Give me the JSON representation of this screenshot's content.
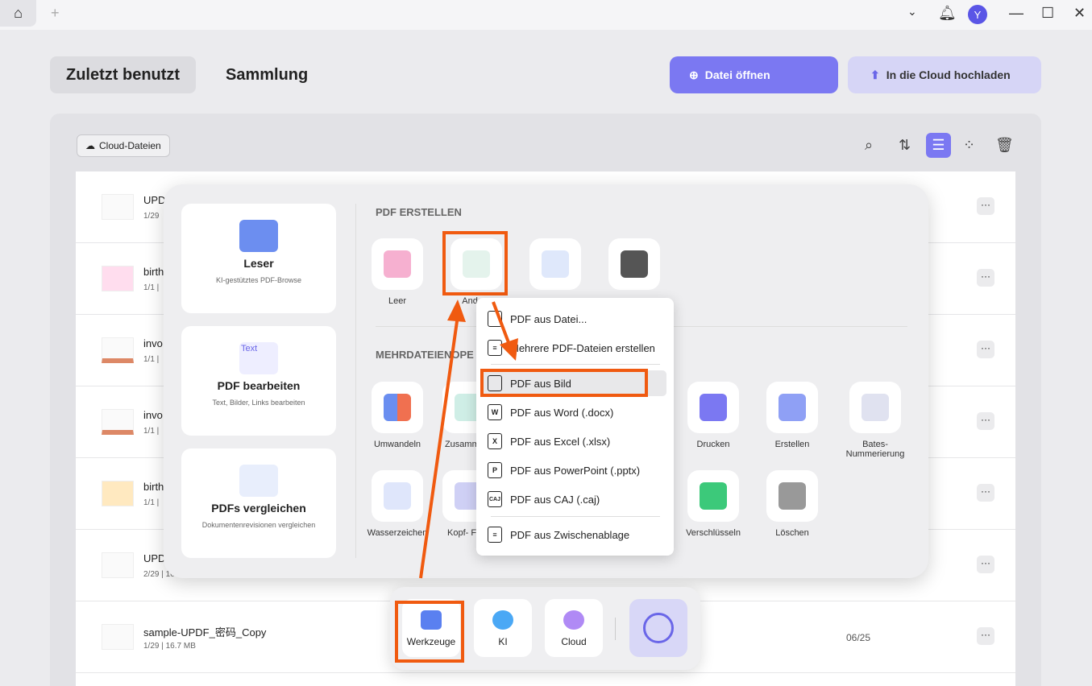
{
  "titlebar": {
    "home_icon": "home-icon",
    "add_tab": "+",
    "avatar": "Y"
  },
  "tabs": [
    {
      "label": "Zuletzt benutzt",
      "active": true
    },
    {
      "label": "Sammlung"
    }
  ],
  "actions": {
    "open": "Datei öffnen",
    "upload": "In die Cloud hochladen"
  },
  "cloud_files": "Cloud-Dateien",
  "files": [
    {
      "name": "UPDF",
      "meta": "1/29"
    },
    {
      "name": "birth",
      "meta": "1/1 |"
    },
    {
      "name": "invo",
      "meta": "1/1 |"
    },
    {
      "name": "invo",
      "meta": "1/1 |"
    },
    {
      "name": "birth",
      "meta": "1/1 |"
    },
    {
      "name": "UPD",
      "meta": "2/29 | 16."
    },
    {
      "name": "sample-UPDF_密码_Copy",
      "meta": "1/29 | 16.7 MB",
      "date": "06/25"
    }
  ],
  "tools_panel": {
    "cards": [
      {
        "title": "Leser",
        "sub": "KI-gestütztes PDF-Browse"
      },
      {
        "title": "PDF bearbeiten",
        "sub": "Text, Bilder, Links bearbeiten",
        "icon_text": "Text"
      },
      {
        "title": "PDFs vergleichen",
        "sub": "Dokumentenrevisionen vergleichen"
      }
    ],
    "create_heading": "PDF ERSTELLEN",
    "create_tools": [
      "Leer",
      "Andere",
      "",
      ""
    ],
    "multi_heading": "MEHRDATEIENOPE",
    "row1": [
      "Umwandeln",
      "Zusammenf",
      "Drucken",
      "Erstellen",
      "Bates-Nummerierung"
    ],
    "row2": [
      "Wasserzeichen",
      "Kopf- Fuß.",
      "Verschlüsseln",
      "Löschen"
    ]
  },
  "menu": [
    {
      "label": "PDF aus Datei...",
      "icon": ""
    },
    {
      "label": "Mehrere PDF-Dateien erstellen",
      "icon": "≡"
    },
    {
      "label": "PDF aus Bild",
      "icon": "",
      "highlighted": true
    },
    {
      "label": "PDF aus Word (.docx)",
      "icon": "W"
    },
    {
      "label": "PDF aus Excel (.xlsx)",
      "icon": "X"
    },
    {
      "label": "PDF aus PowerPoint (.pptx)",
      "icon": "P"
    },
    {
      "label": "PDF aus CAJ (.caj)",
      "icon": "CAJ"
    },
    {
      "label": "PDF aus Zwischenablage",
      "icon": "≡"
    }
  ],
  "dock": [
    {
      "label": "Werkzeuge"
    },
    {
      "label": "KI"
    },
    {
      "label": "Cloud"
    }
  ],
  "colors": {
    "accent": "#7b78f2",
    "annotation": "#f05a10"
  }
}
